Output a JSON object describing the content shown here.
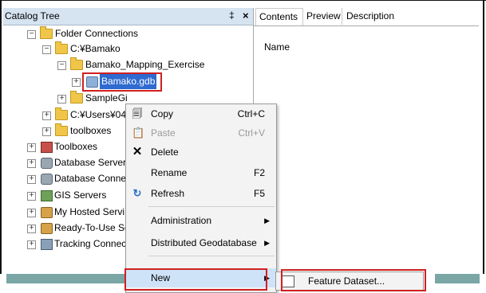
{
  "catalog": {
    "title": "Catalog Tree",
    "pin": "‡",
    "close": "×",
    "tree": [
      {
        "label": "Folder Connections",
        "expander": "−",
        "icon": "folder-connections-icon"
      },
      {
        "label": "C:¥Bamako",
        "expander": "−",
        "icon": "folder-icon"
      },
      {
        "label": "Bamako_Mapping_Exercise",
        "expander": "−",
        "icon": "folder-icon"
      },
      {
        "label": "Bamako.gdb",
        "expander": "+",
        "icon": "geodatabase-icon",
        "selected": true
      },
      {
        "label": "SampleGi",
        "expander": "+",
        "icon": "folder-icon"
      },
      {
        "label": "C:¥Users¥043",
        "expander": "+",
        "icon": "folder-icon"
      },
      {
        "label": "toolboxes",
        "expander": "+",
        "icon": "folder-icon"
      },
      {
        "label": "Toolboxes",
        "expander": "+",
        "icon": "toolboxes-icon"
      },
      {
        "label": "Database Servers",
        "expander": "+",
        "icon": "database-servers-icon"
      },
      {
        "label": "Database Connec",
        "expander": "+",
        "icon": "database-connections-icon"
      },
      {
        "label": "GIS Servers",
        "expander": "+",
        "icon": "gis-servers-icon"
      },
      {
        "label": "My Hosted Servi",
        "expander": "+",
        "icon": "hosted-services-icon"
      },
      {
        "label": "Ready-To-Use Se",
        "expander": "+",
        "icon": "ready-to-use-icon"
      },
      {
        "label": "Tracking Connec",
        "expander": "+",
        "icon": "tracking-connections-icon"
      }
    ]
  },
  "contents": {
    "tabs": [
      "Contents",
      "Preview",
      "Description"
    ],
    "column_name": "Name"
  },
  "context_menu": {
    "items": [
      {
        "label": "Copy",
        "shortcut": "Ctrl+C",
        "icon": "copy-icon",
        "enabled": true
      },
      {
        "label": "Paste",
        "shortcut": "Ctrl+V",
        "icon": "paste-icon",
        "enabled": false
      },
      {
        "label": "Delete",
        "shortcut": "",
        "icon": "delete-icon",
        "enabled": true
      },
      {
        "label": "Rename",
        "shortcut": "F2",
        "icon": "",
        "enabled": true
      },
      {
        "label": "Refresh",
        "shortcut": "F5",
        "icon": "refresh-icon",
        "enabled": true
      },
      {
        "label": "Administration",
        "shortcut": "",
        "submenu": true,
        "enabled": true
      },
      {
        "label": "Distributed Geodatabase",
        "shortcut": "",
        "submenu": true,
        "enabled": true
      },
      {
        "label": "New",
        "shortcut": "",
        "submenu": true,
        "enabled": true,
        "highlighted": true
      }
    ],
    "arrow": "▶"
  },
  "submenu": {
    "item": {
      "label": "Feature Dataset...",
      "icon": "feature-dataset-icon"
    }
  },
  "colors": {
    "selection": "#2f6ad0",
    "highlight_box": "#d02020",
    "menu_highlight": "#cfe3f8"
  }
}
